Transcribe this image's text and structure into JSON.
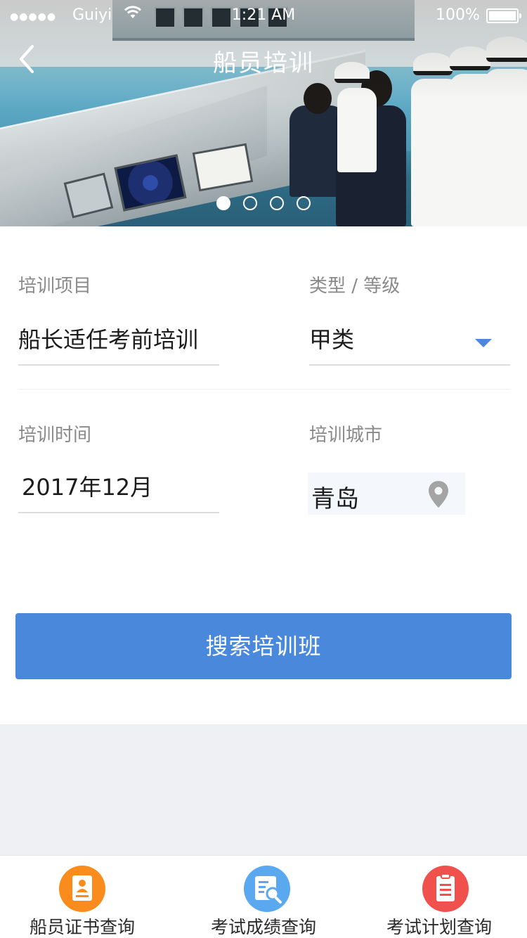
{
  "status_bar": {
    "signal": "●●●●●",
    "carrier": "Guiyi",
    "time": "1:21 AM",
    "battery": "100%"
  },
  "nav": {
    "title": "船员培训",
    "back_icon": "chevron-left-icon"
  },
  "carousel": {
    "slide_count": 4,
    "active_index": 0
  },
  "form": {
    "project_label": "培训项目",
    "project_value": "船长适任考前培训",
    "type_label": "类型 / 等级",
    "type_value": "甲类",
    "time_label": "培训时间",
    "time_value": "2017年12月",
    "city_label": "培训城市",
    "city_value": "青岛",
    "search_button": "搜索培训班"
  },
  "tabbar": {
    "items": [
      {
        "label": "船员证书查询",
        "icon": "certificate-icon",
        "color": "#fa8c1e"
      },
      {
        "label": "考试成绩查询",
        "icon": "score-search-icon",
        "color": "#5aa8f0"
      },
      {
        "label": "考试计划查询",
        "icon": "clipboard-icon",
        "color": "#f0514c"
      }
    ]
  },
  "colors": {
    "accent": "#4a88dc",
    "page_background": "#eff0f4"
  }
}
